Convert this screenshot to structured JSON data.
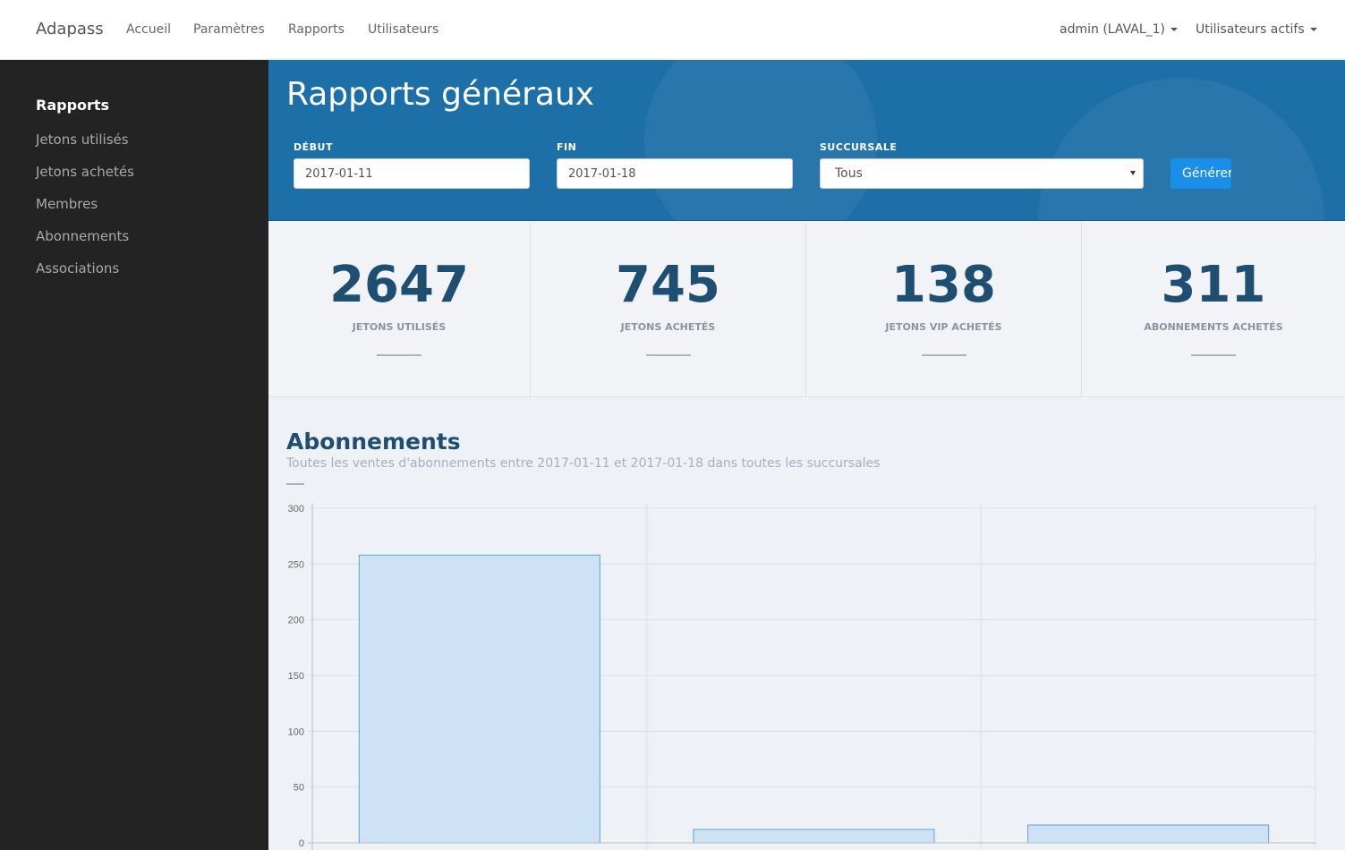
{
  "nav": {
    "brand": "Adapass",
    "links": [
      "Accueil",
      "Paramètres",
      "Rapports",
      "Utilisateurs"
    ],
    "user": "admin (LAVAL_1)",
    "active_users": "Utilisateurs actifs"
  },
  "sidebar": {
    "title": "Rapports",
    "items": [
      "Jetons utilisés",
      "Jetons achetés",
      "Membres",
      "Abonnements",
      "Associations"
    ]
  },
  "header": {
    "title": "Rapports généraux",
    "start_label": "DÉBUT",
    "start_value": "2017-01-11",
    "end_label": "FIN",
    "end_value": "2017-01-18",
    "branch_label": "SUCCURSALE",
    "branch_value": "Tous",
    "generate_label": "Générer"
  },
  "stats": [
    {
      "value": "2647",
      "label": "JETONS UTILISÉS"
    },
    {
      "value": "745",
      "label": "JETONS ACHETÉS"
    },
    {
      "value": "138",
      "label": "JETONS VIP ACHETÉS"
    },
    {
      "value": "311",
      "label": "ABONNEMENTS ACHETÉS"
    }
  ],
  "section": {
    "title": "Abonnements",
    "subtitle": "Toutes les ventes d'abonnements entre 2017-01-11 et 2017-01-18 dans toutes les succursales"
  },
  "chart_data": {
    "type": "bar",
    "categories": [
      "",
      "",
      ""
    ],
    "values": [
      258,
      12,
      16
    ],
    "ylim": [
      0,
      300
    ],
    "yticks": [
      0,
      50,
      100,
      150,
      200,
      250,
      300
    ],
    "grid": true,
    "bar_fill": "#cde2f5",
    "bar_stroke": "#5aa5dc"
  }
}
